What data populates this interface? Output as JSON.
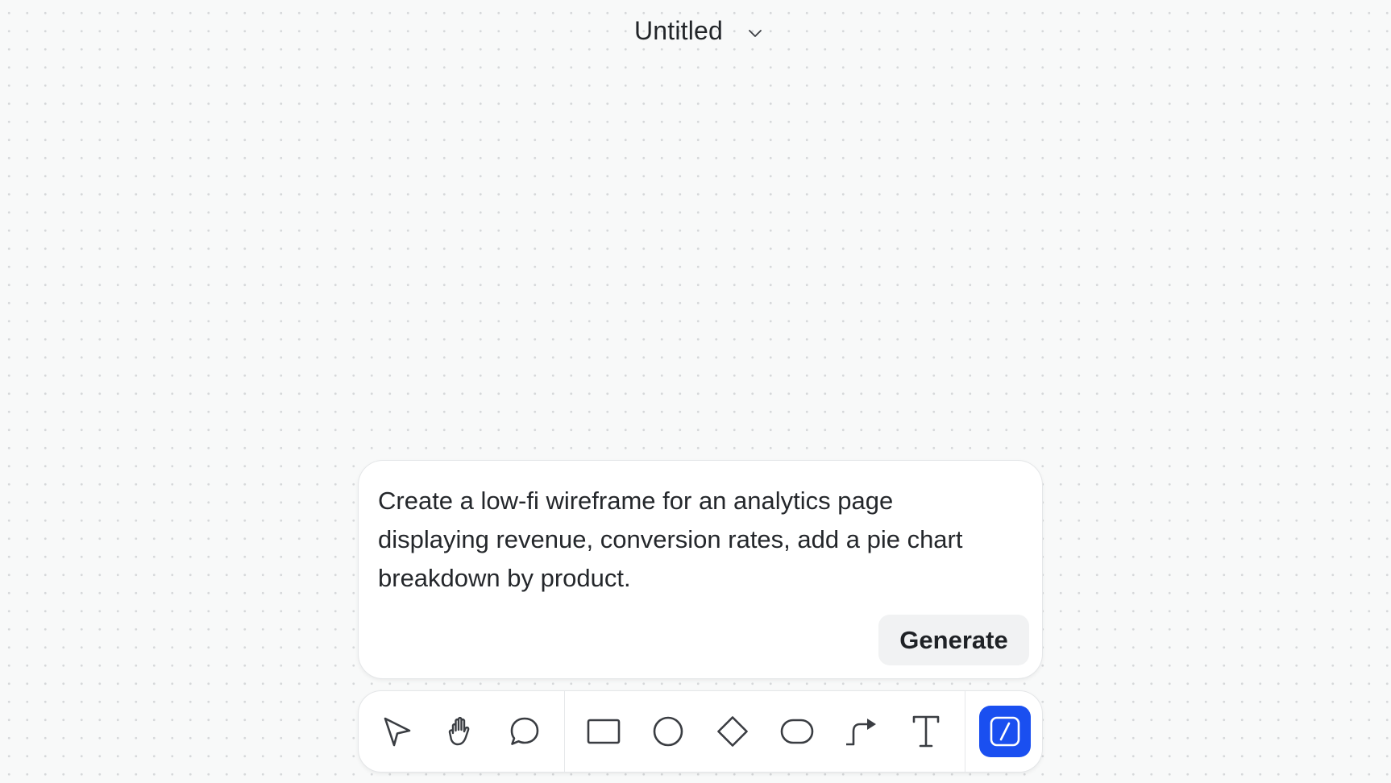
{
  "header": {
    "title": "Untitled",
    "title_menu_icon": "chevron-down-icon"
  },
  "prompt": {
    "text": "Create a low-fi wireframe for an analytics page\ndisplaying revenue, conversion rates, add a pie chart\nbreakdown by product.",
    "generate_label": "Generate"
  },
  "toolbar": {
    "tools": [
      {
        "name": "select",
        "icon": "pointer-icon",
        "active": false
      },
      {
        "name": "hand",
        "icon": "hand-icon",
        "active": false
      },
      {
        "name": "comment",
        "icon": "speech-bubble-icon",
        "active": false
      },
      {
        "name": "rectangle",
        "icon": "rectangle-icon",
        "active": false
      },
      {
        "name": "ellipse",
        "icon": "circle-icon",
        "active": false
      },
      {
        "name": "diamond",
        "icon": "diamond-icon",
        "active": false
      },
      {
        "name": "rounded-rectangle",
        "icon": "pill-icon",
        "active": false
      },
      {
        "name": "connector",
        "icon": "connector-arrow-icon",
        "active": false
      },
      {
        "name": "text",
        "icon": "text-icon",
        "active": false
      },
      {
        "name": "ai-generate",
        "icon": "slash-icon",
        "active": true
      }
    ],
    "active_color": "#1a4ff0"
  },
  "colors": {
    "canvas_background": "#f8f9f9",
    "canvas_dot": "#d6d8da",
    "icon_stroke": "#3a3d42",
    "accent": "#1a4ff0"
  }
}
